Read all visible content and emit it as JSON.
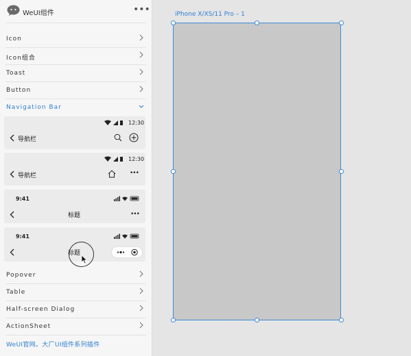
{
  "app": {
    "title": "WeUI组件",
    "more": "•••"
  },
  "menu": [
    {
      "label": "Icon"
    },
    {
      "label": "Icon组合"
    },
    {
      "label": "Toast"
    },
    {
      "label": "Button"
    },
    {
      "label": "Navigation Bar",
      "active": true,
      "expanded": true
    },
    {
      "label": "Popover"
    },
    {
      "label": "Table"
    },
    {
      "label": "Half-screen Dialog"
    },
    {
      "label": "ActionSheet"
    }
  ],
  "nav_variants": [
    {
      "time": "12:30",
      "title": "导航栏",
      "right_icons": [
        "search-icon",
        "add-circle-icon"
      ]
    },
    {
      "time": "12:30",
      "title": "导航栏",
      "right_icons": [
        "home-icon",
        "more-icon"
      ]
    },
    {
      "time": "9:41",
      "title": "标题",
      "right_icons": [
        "more-icon"
      ]
    },
    {
      "time": "9:41",
      "title": "标题",
      "right_icons": [
        "capsule-menu-icon",
        "capsule-close-icon"
      ]
    }
  ],
  "footer": {
    "text": "WeUI官网。大厂UI组件系列插件"
  },
  "canvas": {
    "frame_label": "iPhone X/XS/11 Pro – 1"
  },
  "colors": {
    "accent": "#2f7fd0",
    "selection": "#3b8ad8",
    "frame_fill": "#c8c8c8",
    "canvas_bg": "#e5e5e5",
    "panel_bg": "#f6f6f6"
  }
}
